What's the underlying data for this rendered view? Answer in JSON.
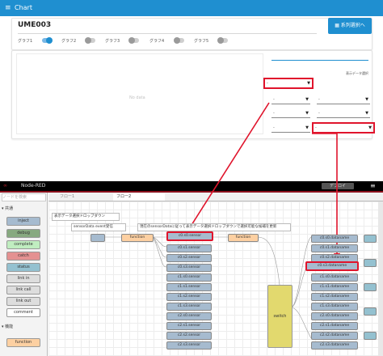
{
  "dashboard": {
    "header_title": "Chart",
    "page_title": "UME003",
    "series_button": "系列選択へ",
    "toggles": [
      {
        "label": "グラフ1",
        "on": true
      },
      {
        "label": "グラフ2",
        "on": false
      },
      {
        "label": "グラフ3",
        "on": false
      },
      {
        "label": "グラフ4",
        "on": false
      },
      {
        "label": "グラフ5",
        "on": false
      }
    ],
    "chart_placeholder": "No data",
    "dropdown_label": "表示データ選択",
    "dropdown_value": "-"
  },
  "nodered": {
    "app_name": "Node-RED",
    "deploy_label": "デプロイ",
    "filter_placeholder": "ノードを検索",
    "categories": [
      "共通",
      "機能"
    ],
    "palette_nodes": [
      "inject",
      "debug",
      "complete",
      "catch",
      "status",
      "link in",
      "link call",
      "link out",
      "comment",
      "function"
    ],
    "tabs": [
      "フロー1",
      "フロー2"
    ],
    "comments": [
      "表示データ選択ドロップダウン",
      "sensorData event受信",
      "現在のsensorDataに従って表示データ選択ドロップダウンで選択可能な候補を更新"
    ],
    "function_label": "function",
    "switch_label": "switch",
    "sensor_nodes": [
      "c0.s0.sensor",
      "c0.s1.sensor",
      "c0.s2.sensor",
      "c0.s3.sensor",
      "c1.s0.sensor",
      "c1.s1.sensor",
      "c1.s2.sensor",
      "c1.s3.sensor",
      "c2.s0.sensor",
      "c2.s1.sensor",
      "c2.s2.sensor",
      "c2.s3.sensor"
    ],
    "dataname_nodes": [
      "c0.s0.dataname",
      "c0.s1.dataname",
      "c0.s2.dataname",
      "c0.s3.dataname",
      "c1.s0.dataname",
      "c1.s1.dataname",
      "c1.s2.dataname",
      "c1.s3.dataname",
      "c2.s0.dataname",
      "c2.s1.dataname",
      "c2.s2.dataname",
      "c2.s3.dataname"
    ]
  },
  "colors": {
    "accent": "#1f8fd0",
    "highlight": "#e0142c",
    "function": "#fdd0a2",
    "switch": "#e2d96e"
  }
}
